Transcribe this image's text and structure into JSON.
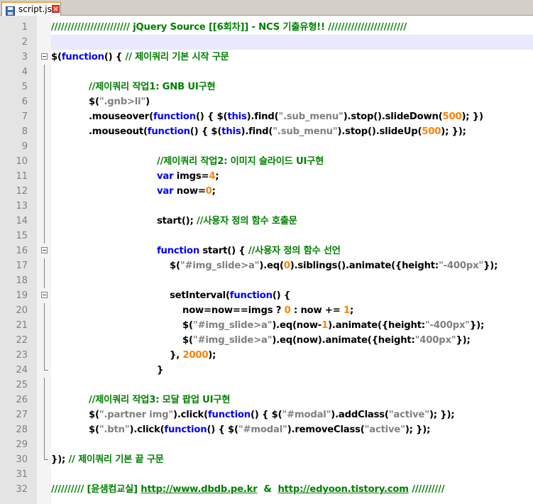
{
  "tab": {
    "filename": "script.js",
    "icon": "save-file-icon",
    "close_icon": "close-icon"
  },
  "colors": {
    "comment": "#008000",
    "keyword": "#0000ff",
    "string": "#808080",
    "number": "#ff8000",
    "default": "#000000",
    "gutter": "#e4e4e4",
    "current_line": "#e8e8ff"
  },
  "current_line": 2,
  "lines": [
    {
      "n": "1",
      "tokens": [
        {
          "t": "//////////////////////// jQuery Source [[6회차]] - NCS 기출유형!! ////////////////////////",
          "c": "cm"
        }
      ]
    },
    {
      "n": "2",
      "tokens": []
    },
    {
      "n": "3",
      "tokens": [
        {
          "t": "$(",
          "c": "df"
        },
        {
          "t": "function",
          "c": "kw"
        },
        {
          "t": "() { ",
          "c": "df"
        },
        {
          "t": "// 제이쿼리 기본 시작 구문",
          "c": "cm"
        }
      ]
    },
    {
      "n": "4",
      "tokens": []
    },
    {
      "n": "5",
      "tokens": [
        {
          "t": "//제이쿼리 작업1: GNB UI구현",
          "c": "cm"
        }
      ]
    },
    {
      "n": "6",
      "tokens": [
        {
          "t": "$(",
          "c": "df"
        },
        {
          "t": "\".gnb>li\"",
          "c": "st"
        },
        {
          "t": ")",
          "c": "df"
        }
      ]
    },
    {
      "n": "7",
      "tokens": [
        {
          "t": ".mouseover(",
          "c": "df"
        },
        {
          "t": "function",
          "c": "kw"
        },
        {
          "t": "() { $(",
          "c": "df"
        },
        {
          "t": "this",
          "c": "kw"
        },
        {
          "t": ").find(",
          "c": "df"
        },
        {
          "t": "\".sub_menu\"",
          "c": "st"
        },
        {
          "t": ").stop().slideDown(",
          "c": "df"
        },
        {
          "t": "500",
          "c": "nu"
        },
        {
          "t": "); })",
          "c": "df"
        }
      ]
    },
    {
      "n": "8",
      "tokens": [
        {
          "t": ".mouseout(",
          "c": "df"
        },
        {
          "t": "function",
          "c": "kw"
        },
        {
          "t": "() { $(",
          "c": "df"
        },
        {
          "t": "this",
          "c": "kw"
        },
        {
          "t": ").find(",
          "c": "df"
        },
        {
          "t": "\".sub_menu\"",
          "c": "st"
        },
        {
          "t": ").stop().slideUp(",
          "c": "df"
        },
        {
          "t": "500",
          "c": "nu"
        },
        {
          "t": "); });",
          "c": "df"
        }
      ]
    },
    {
      "n": "9",
      "tokens": []
    },
    {
      "n": "10",
      "tokens": [
        {
          "t": "//제이쿼리 작업2: 이미지 슬라이드 UI구현",
          "c": "cm"
        }
      ]
    },
    {
      "n": "11",
      "tokens": [
        {
          "t": "var",
          "c": "kw"
        },
        {
          "t": " imgs=",
          "c": "df"
        },
        {
          "t": "4",
          "c": "nu"
        },
        {
          "t": ";",
          "c": "df"
        }
      ]
    },
    {
      "n": "12",
      "tokens": [
        {
          "t": "var",
          "c": "kw"
        },
        {
          "t": " now=",
          "c": "df"
        },
        {
          "t": "0",
          "c": "nu"
        },
        {
          "t": ";",
          "c": "df"
        }
      ]
    },
    {
      "n": "13",
      "tokens": []
    },
    {
      "n": "14",
      "tokens": [
        {
          "t": "start(); ",
          "c": "df"
        },
        {
          "t": "//사용자 정의 함수 호출문",
          "c": "cm"
        }
      ]
    },
    {
      "n": "15",
      "tokens": []
    },
    {
      "n": "16",
      "tokens": [
        {
          "t": "function",
          "c": "kw"
        },
        {
          "t": " start() { ",
          "c": "df"
        },
        {
          "t": "//사용자 정의 함수 선언",
          "c": "cm"
        }
      ]
    },
    {
      "n": "17",
      "tokens": [
        {
          "t": "$(",
          "c": "df"
        },
        {
          "t": "\"#img_slide>a\"",
          "c": "st"
        },
        {
          "t": ").eq(",
          "c": "df"
        },
        {
          "t": "0",
          "c": "nu"
        },
        {
          "t": ").siblings().animate({height:",
          "c": "df"
        },
        {
          "t": "\"-400px\"",
          "c": "st"
        },
        {
          "t": "});",
          "c": "df"
        }
      ]
    },
    {
      "n": "18",
      "tokens": []
    },
    {
      "n": "19",
      "tokens": [
        {
          "t": "setInterval(",
          "c": "df"
        },
        {
          "t": "function",
          "c": "kw"
        },
        {
          "t": "() {",
          "c": "df"
        }
      ]
    },
    {
      "n": "20",
      "tokens": [
        {
          "t": "now=now==imgs ? ",
          "c": "df"
        },
        {
          "t": "0",
          "c": "nu"
        },
        {
          "t": " : now += ",
          "c": "df"
        },
        {
          "t": "1",
          "c": "nu"
        },
        {
          "t": ";",
          "c": "df"
        }
      ]
    },
    {
      "n": "21",
      "tokens": [
        {
          "t": "$(",
          "c": "df"
        },
        {
          "t": "\"#img_slide>a\"",
          "c": "st"
        },
        {
          "t": ").eq(now-",
          "c": "df"
        },
        {
          "t": "1",
          "c": "nu"
        },
        {
          "t": ").animate({height:",
          "c": "df"
        },
        {
          "t": "\"-400px\"",
          "c": "st"
        },
        {
          "t": "});",
          "c": "df"
        }
      ]
    },
    {
      "n": "22",
      "tokens": [
        {
          "t": "$(",
          "c": "df"
        },
        {
          "t": "\"#img_slide>a\"",
          "c": "st"
        },
        {
          "t": ").eq(now).animate({height:",
          "c": "df"
        },
        {
          "t": "\"400px\"",
          "c": "st"
        },
        {
          "t": "});",
          "c": "df"
        }
      ]
    },
    {
      "n": "23",
      "tokens": [
        {
          "t": "}, ",
          "c": "df"
        },
        {
          "t": "2000",
          "c": "nu"
        },
        {
          "t": ");",
          "c": "df"
        }
      ]
    },
    {
      "n": "24",
      "tokens": [
        {
          "t": "}",
          "c": "df"
        }
      ]
    },
    {
      "n": "25",
      "tokens": []
    },
    {
      "n": "26",
      "tokens": [
        {
          "t": "//제이쿼리 작업3: 모달 팝업 UI구현",
          "c": "cm"
        }
      ]
    },
    {
      "n": "27",
      "tokens": [
        {
          "t": "$(",
          "c": "df"
        },
        {
          "t": "\".partner img\"",
          "c": "st"
        },
        {
          "t": ").click(",
          "c": "df"
        },
        {
          "t": "function",
          "c": "kw"
        },
        {
          "t": "() { $(",
          "c": "df"
        },
        {
          "t": "\"#modal\"",
          "c": "st"
        },
        {
          "t": ").addClass(",
          "c": "df"
        },
        {
          "t": "\"active\"",
          "c": "st"
        },
        {
          "t": "); });",
          "c": "df"
        }
      ]
    },
    {
      "n": "28",
      "tokens": [
        {
          "t": "$(",
          "c": "df"
        },
        {
          "t": "\".btn\"",
          "c": "st"
        },
        {
          "t": ").click(",
          "c": "df"
        },
        {
          "t": "function",
          "c": "kw"
        },
        {
          "t": "() { $(",
          "c": "df"
        },
        {
          "t": "\"#modal\"",
          "c": "st"
        },
        {
          "t": ").removeClass(",
          "c": "df"
        },
        {
          "t": "\"active\"",
          "c": "st"
        },
        {
          "t": "); });",
          "c": "df"
        }
      ]
    },
    {
      "n": "29",
      "tokens": []
    },
    {
      "n": "30",
      "tokens": [
        {
          "t": "}); ",
          "c": "df"
        },
        {
          "t": "// 제이쿼리 기본 끝 구문",
          "c": "cm"
        }
      ]
    },
    {
      "n": "31",
      "tokens": []
    },
    {
      "n": "32",
      "tokens": [
        {
          "t": "////////// [윤샘컴교실] ",
          "c": "cm"
        },
        {
          "t": "http://www.dbdb.pe.kr",
          "c": "url"
        },
        {
          "t": "  &  ",
          "c": "cm"
        },
        {
          "t": "http://edyoon.tistory.com",
          "c": "url"
        },
        {
          "t": " //////////",
          "c": "cm"
        }
      ]
    }
  ]
}
